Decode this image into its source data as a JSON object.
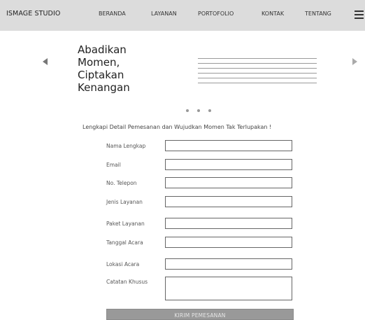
{
  "navbar": {
    "brand": "ISMAGE STUDIO",
    "items": [
      {
        "label": "BERANDA"
      },
      {
        "label": "LAYANAN"
      },
      {
        "label": "PORTOFOLIO"
      },
      {
        "label": "KONTAK"
      },
      {
        "label": "TENTANG"
      }
    ],
    "menu_icon": "hamburger-menu-icon"
  },
  "carousel": {
    "title": "Abadikan\nMomen,\nCiptakan\nKenangan",
    "prev_icon": "triangle-left-icon",
    "next_icon": "triangle-right-icon",
    "slide_count": 3
  },
  "form": {
    "heading": "Lengkapi Detail Pemesanan dan Wujudkan Momen Tak Terlupakan !",
    "fields": [
      {
        "label": "Nama Lengkap",
        "value": ""
      },
      {
        "label": "Email",
        "value": ""
      },
      {
        "label": "No. Telepon",
        "value": ""
      },
      {
        "label": "Jenis Layanan",
        "value": ""
      },
      {
        "label": "Paket Layanan",
        "value": ""
      },
      {
        "label": "Tanggal Acara",
        "value": ""
      },
      {
        "label": "Lokasi Acara",
        "value": ""
      },
      {
        "label": "Catatan Khusus",
        "value": ""
      }
    ],
    "submit_label": "KIRIM PEMESANAN"
  }
}
